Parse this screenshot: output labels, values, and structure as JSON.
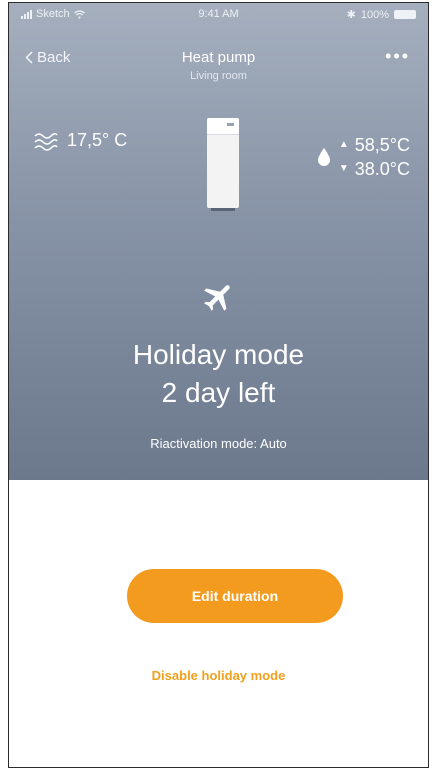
{
  "status_bar": {
    "carrier": "Sketch",
    "time": "9:41 AM",
    "battery": "100%"
  },
  "nav": {
    "back_label": "Back",
    "title": "Heat pump",
    "subtitle": "Living room",
    "more_label": "•••"
  },
  "readings": {
    "outdoor_temp": "17,5° C",
    "water_temp_high": "58,5°C",
    "water_temp_low": "38.0°C"
  },
  "holiday": {
    "title": "Holiday mode",
    "days_left": "2 day left",
    "reactivation": "Riactivation mode: Auto"
  },
  "actions": {
    "edit_duration": "Edit duration",
    "disable_holiday": "Disable holiday mode"
  },
  "icons": {
    "outdoor": "wind-waves-icon",
    "device": "heat-pump-unit-icon",
    "water": "water-drop-icon",
    "mode": "airplane-icon"
  },
  "colors": {
    "accent": "#f29b1f",
    "hero_top": "#a5afbe",
    "hero_bottom": "#6c788c"
  }
}
